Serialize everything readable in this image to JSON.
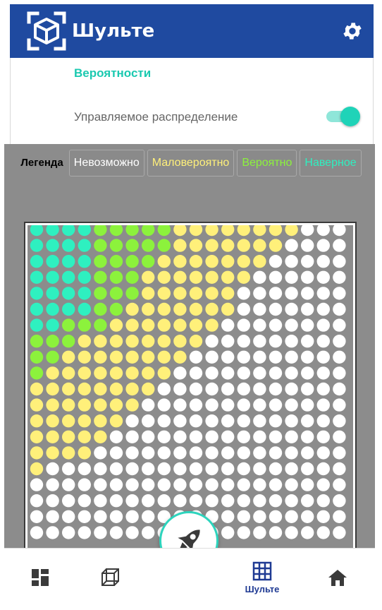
{
  "app": {
    "title": "Шульте"
  },
  "settings": {
    "probabilities_title": "Вероятности",
    "managed_distribution_label": "Управляемое распределение",
    "managed_distribution_on": true
  },
  "legend": {
    "label": "Легенда",
    "items": [
      {
        "label": "Невозможно",
        "color": "#ffffff"
      },
      {
        "label": "Маловероятно",
        "color": "#fff07a"
      },
      {
        "label": "Вероятно",
        "color": "#8cf23c"
      },
      {
        "label": "Наверное",
        "color": "#2ef0c0"
      }
    ]
  },
  "grid": {
    "columns": 20,
    "rows": 20,
    "zone_colors": [
      "#ffffff",
      "#fff07a",
      "#8cf23c",
      "#2ef0c0"
    ],
    "background": "#8c8c8c"
  },
  "nav": {
    "items": [
      {
        "name": "dashboard",
        "icon": "grid-4-icon",
        "label": ""
      },
      {
        "name": "cube",
        "icon": "cube-outline-icon",
        "label": ""
      },
      {
        "name": "schulte",
        "icon": "table-grid-icon",
        "label": "Шульте",
        "active": true
      },
      {
        "name": "home",
        "icon": "home-icon",
        "label": ""
      }
    ],
    "fab_icon": "rocket-icon"
  }
}
